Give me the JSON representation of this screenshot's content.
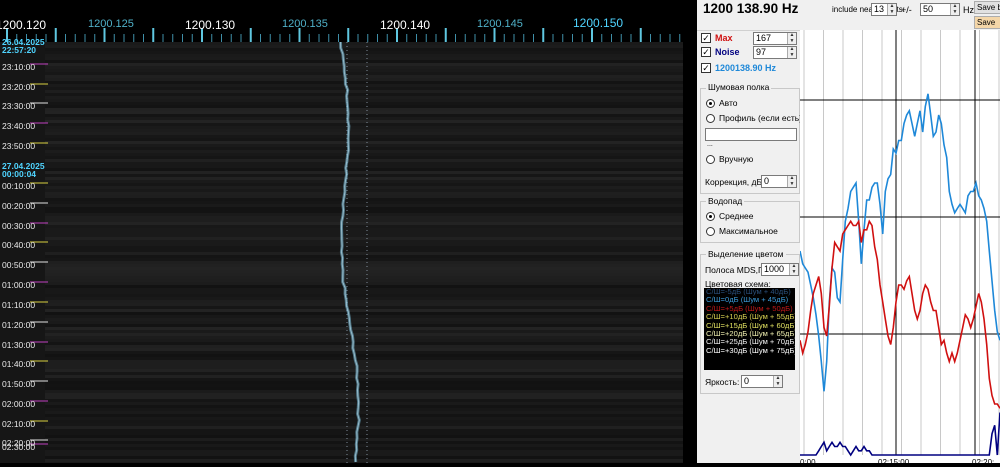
{
  "waterfall": {
    "freq_labels": [
      {
        "text": "1200.120",
        "style": "major"
      },
      {
        "text": "1200.125",
        "style": "minor"
      },
      {
        "text": "1200.130",
        "style": "major"
      },
      {
        "text": "1200.135",
        "style": "minor"
      },
      {
        "text": "1200.140",
        "style": "major"
      },
      {
        "text": "1200.145",
        "style": "minor"
      },
      {
        "text": "1200.150",
        "style": "cyan"
      }
    ],
    "time_labels": [
      {
        "text": "26.04.2025",
        "style": "date"
      },
      {
        "text": "22:57:20",
        "style": "date"
      },
      {
        "text": "23:10:00",
        "style": "time"
      },
      {
        "text": "23:20:00",
        "style": "time"
      },
      {
        "text": "23:30:00",
        "style": "time"
      },
      {
        "text": "23:40:00",
        "style": "time"
      },
      {
        "text": "23:50:00",
        "style": "time"
      },
      {
        "text": "27.04.2025",
        "style": "date"
      },
      {
        "text": "00:00:04",
        "style": "date"
      },
      {
        "text": "00:10:00",
        "style": "time"
      },
      {
        "text": "00:20:00",
        "style": "time"
      },
      {
        "text": "00:30:00",
        "style": "time"
      },
      {
        "text": "00:40:00",
        "style": "time"
      },
      {
        "text": "00:50:00",
        "style": "time"
      },
      {
        "text": "01:00:00",
        "style": "time"
      },
      {
        "text": "01:10:00",
        "style": "time"
      },
      {
        "text": "01:20:00",
        "style": "time"
      },
      {
        "text": "01:30:00",
        "style": "time"
      },
      {
        "text": "01:40:00",
        "style": "time"
      },
      {
        "text": "01:50:00",
        "style": "time"
      },
      {
        "text": "02:00:00",
        "style": "time"
      },
      {
        "text": "02:10:00",
        "style": "time"
      },
      {
        "text": "02:20:00",
        "style": "time"
      },
      {
        "text": "02:30:00",
        "style": "time"
      }
    ]
  },
  "panel": {
    "freq_title": "1200 138.90 Hz",
    "nearby_label": "include nearby slots:",
    "nearby_value": "13",
    "pm_label": "+/-",
    "pm_value": "50",
    "hz_label": "Hz",
    "save_btn_1": "Save b",
    "save_btn_2": "Save",
    "max": {
      "label": "Max",
      "value": "167",
      "color": "#d01010"
    },
    "noise": {
      "label": "Noise",
      "value": "97",
      "color": "#000080"
    },
    "freq_check": {
      "label": "1200138.90 Hz",
      "color": "#1e88d8"
    },
    "noise_shelf": {
      "title": "Шумовая полка",
      "auto": "Авто",
      "profile": "Профиль (если есть)",
      "dots": "...",
      "manual": "Вручную",
      "correction_label": "Коррекция, дБ:",
      "correction_value": "0"
    },
    "waterfall_mode": {
      "title": "Водопад",
      "avg": "Среднее",
      "max": "Максимальное"
    },
    "color_highlight": {
      "title": "Выделение цветом",
      "band_label": "Полоса MDS,Гц",
      "band_value": "1000",
      "scheme_label": "Цветовая схема:",
      "legend": [
        {
          "text": "С/Ш=-5дБ (Шум + 40дБ)",
          "color": "#2a4f7a"
        },
        {
          "text": "С/Ш=0дБ (Шум + 45дБ)",
          "color": "#3c9ad8"
        },
        {
          "text": "С/Ш=+5дБ (Шум + 50дБ)",
          "color": "#c01818"
        },
        {
          "text": "С/Ш=+10дБ (Шум + 55дБ)",
          "color": "#d8d050"
        },
        {
          "text": "С/Ш=+15дБ (Шум + 60дБ)",
          "color": "#e0e060"
        },
        {
          "text": "С/Ш=+20дБ (Шум + 65дБ)",
          "color": "#f0f0b0"
        },
        {
          "text": "С/Ш=+25дБ (Шум + 70дБ)",
          "color": "#f4f4f4"
        },
        {
          "text": "С/Ш=+30дБ (Шум + 75дБ)",
          "color": "#ffffff"
        }
      ],
      "brightness_label": "Яркость:",
      "brightness_value": "0"
    }
  },
  "chart_data": {
    "type": "line",
    "x_ticks": [
      "0:00",
      "02:15:00",
      "02:20:"
    ],
    "series": [
      {
        "color": "#1e88d8",
        "values": [
          0.52,
          0.55,
          0.56,
          0.57,
          0.6,
          0.63,
          0.67,
          0.72,
          0.78,
          0.85,
          0.78,
          0.64,
          0.56,
          0.57,
          0.63,
          0.64,
          0.54,
          0.45,
          0.42,
          0.38,
          0.37,
          0.36,
          0.45,
          0.55,
          0.47,
          0.4,
          0.4,
          0.37,
          0.36,
          0.36,
          0.41,
          0.48,
          0.38,
          0.35,
          0.34,
          0.28,
          0.29,
          0.26,
          0.26,
          0.22,
          0.2,
          0.19,
          0.22,
          0.25,
          0.22,
          0.19,
          0.24,
          0.18,
          0.15,
          0.2,
          0.25,
          0.24,
          0.2,
          0.22,
          0.27,
          0.3,
          0.38,
          0.41,
          0.43,
          0.42,
          0.41,
          0.42,
          0.43,
          0.39,
          0.38,
          0.38,
          0.36,
          0.39,
          0.4,
          0.42,
          0.45,
          0.52,
          0.59,
          0.66,
          0.71,
          0.73
        ]
      },
      {
        "color": "#d01010",
        "values": [
          0.73,
          0.76,
          0.74,
          0.71,
          0.66,
          0.62,
          0.6,
          0.58,
          0.62,
          0.7,
          0.72,
          0.65,
          0.56,
          0.5,
          0.51,
          0.52,
          0.48,
          0.47,
          0.46,
          0.45,
          0.46,
          0.46,
          0.45,
          0.5,
          0.47,
          0.47,
          0.45,
          0.46,
          0.51,
          0.54,
          0.6,
          0.64,
          0.68,
          0.72,
          0.74,
          0.7,
          0.64,
          0.6,
          0.6,
          0.61,
          0.59,
          0.58,
          0.62,
          0.66,
          0.68,
          0.66,
          0.62,
          0.6,
          0.61,
          0.64,
          0.66,
          0.66,
          0.7,
          0.74,
          0.73,
          0.76,
          0.78,
          0.76,
          0.78,
          0.76,
          0.73,
          0.7,
          0.67,
          0.68,
          0.7,
          0.68,
          0.65,
          0.62,
          0.64,
          0.68,
          0.74,
          0.82,
          0.86,
          0.88,
          0.88,
          0.89
        ]
      },
      {
        "color": "#000080",
        "values": [
          1,
          1,
          1,
          1,
          1,
          1,
          1,
          0.99,
          0.98,
          0.97,
          0.99,
          0.98,
          0.97,
          0.98,
          0.98,
          0.97,
          0.98,
          0.98,
          0.99,
          1,
          0.99,
          0.98,
          0.99,
          0.99,
          0.98,
          0.99,
          0.99,
          1,
          1,
          1,
          1,
          1,
          1,
          1,
          1,
          1,
          1,
          1,
          1,
          1,
          1,
          1,
          1,
          1,
          1,
          1,
          1,
          1,
          1,
          1,
          1,
          1,
          1,
          1,
          1,
          1,
          1,
          1,
          1,
          1,
          1,
          1,
          1,
          1,
          1,
          1,
          1,
          1,
          1,
          1,
          1,
          1,
          0.95,
          0.93,
          1,
          0.9
        ]
      }
    ]
  }
}
